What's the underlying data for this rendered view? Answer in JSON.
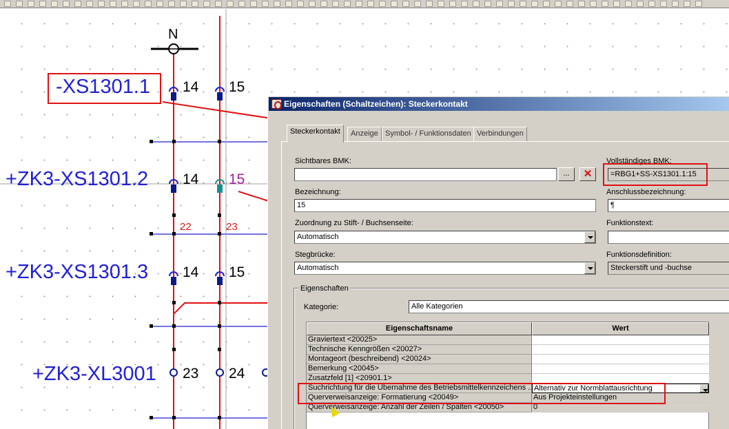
{
  "schematic": {
    "symbol_top": "N",
    "labels": [
      "-XS1301.1",
      "+ZK3-XS1301.2",
      "+ZK3-XS1301.3",
      "+ZK3-XL3001"
    ],
    "pins": {
      "row1": [
        "14",
        "15"
      ],
      "row2": [
        "14",
        "15"
      ],
      "row3": [
        "14",
        "15"
      ],
      "row4": [
        "23",
        "24"
      ]
    },
    "wire_numbers": [
      "22",
      "23"
    ]
  },
  "dialog": {
    "title": "Eigenschaften (Schaltzeichen): Steckerkontakt",
    "tabs": [
      "Steckerkontakt",
      "Anzeige",
      "Symbol- / Funktionsdaten",
      "Verbindungen"
    ],
    "sichtbares_bmk": {
      "label": "Sichtbares BMK:",
      "value": "",
      "browse": "...",
      "clear": "✕"
    },
    "vollstaendiges_bmk": {
      "label": "Vollständiges BMK:",
      "value": "=RBG1+SS-XS1301.1:15"
    },
    "bezeichnung": {
      "label": "Bezeichnung:",
      "value": "15"
    },
    "anschlussbezeichnung": {
      "label": "Anschlussbezeichnung:",
      "value": "¶"
    },
    "zuordnung": {
      "label": "Zuordnung zu Stift- / Buchsenseite:",
      "value": "Automatisch"
    },
    "funktionstext": {
      "label": "Funktionstext:",
      "value": ""
    },
    "stegbruecke": {
      "label": "Stegbrücke:",
      "value": "Automatisch"
    },
    "funktionsdefinition": {
      "label": "Funktionsdefinition:",
      "value": "Steckerstift und -buchse"
    },
    "eigenschaften": {
      "legend": "Eigenschaften",
      "kategorie_label": "Kategorie:",
      "kategorie_value": "Alle Kategorien",
      "columns": [
        "Eigenschaftsname",
        "Wert"
      ],
      "rows": [
        {
          "name": "Graviertext <20025>",
          "value": ""
        },
        {
          "name": "Technische Kenngrößen <20027>",
          "value": ""
        },
        {
          "name": "Montageort (beschreibend) <20024>",
          "value": ""
        },
        {
          "name": "Bemerkung <20045>",
          "value": ""
        },
        {
          "name": "Zusatzfeld [1] <20901.1>",
          "value": ""
        },
        {
          "name": "Suchrichtung für die Übernahme des Betriebsmittelkennzeichens ...",
          "value": "Alternativ zur Normblattausrichtung"
        },
        {
          "name": "Querverweisanzeige: Formatierung <20049>",
          "value": "Aus Projekteinstellungen"
        },
        {
          "name": "Querverweisanzeige: Anzahl der Zeilen / Spalten <20050>",
          "value": "0"
        }
      ]
    }
  },
  "colors": {
    "label_blue": "#1f1fd6",
    "wire_red": "#e01010",
    "wire_blue": "#1f1fd6",
    "highlight_red": "#e01010"
  }
}
